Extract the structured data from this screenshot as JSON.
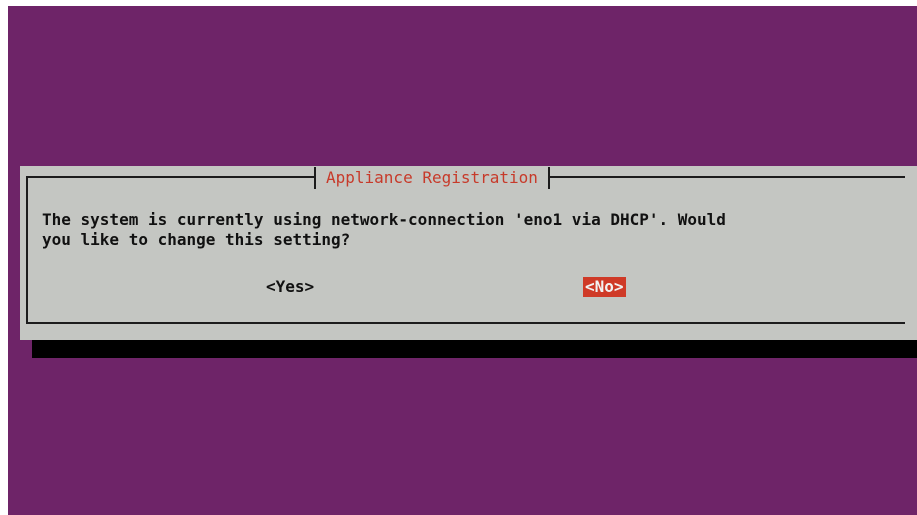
{
  "dialog": {
    "title": "Appliance Registration",
    "message": "The system is currently using network-connection 'eno1 via DHCP'. Would\nyou like to change this setting?",
    "buttons": {
      "yes_label": "<Yes>",
      "no_label": "<No>"
    },
    "focused_button": "no"
  },
  "colors": {
    "background": "#6e2468",
    "dialog": "#c4c6c2",
    "title_text": "#c73a2a",
    "focus_highlight": "#cf3a27",
    "shadow": "#000000"
  }
}
